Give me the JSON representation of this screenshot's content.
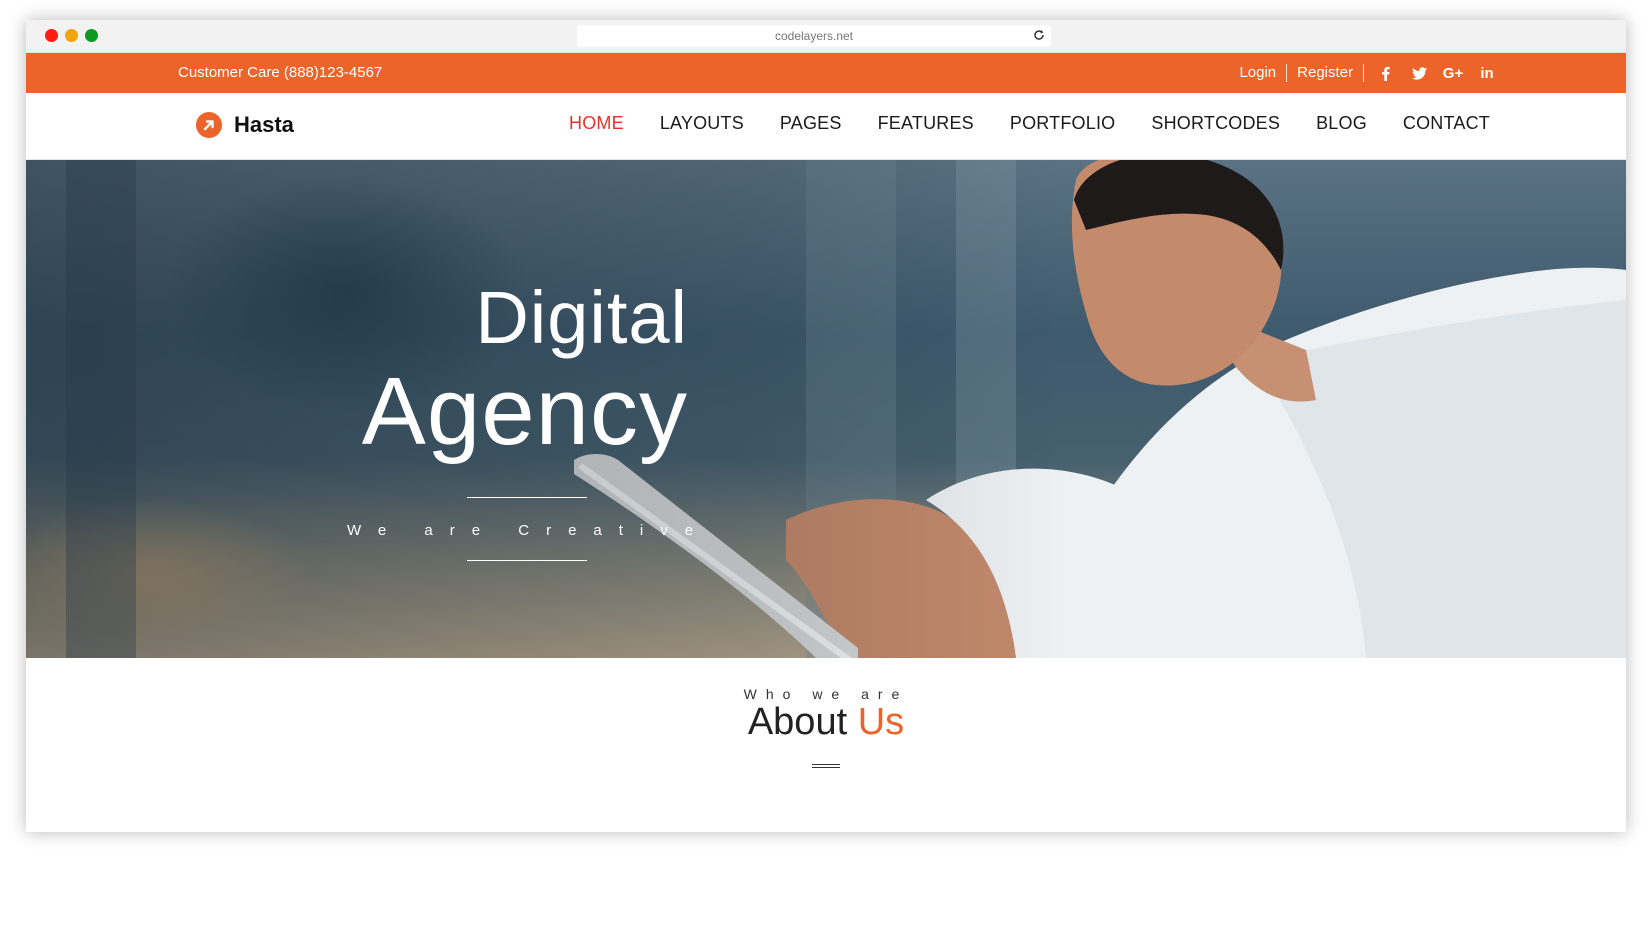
{
  "browser": {
    "url": "codelayers.net",
    "reload_icon": "reload-icon"
  },
  "topbar": {
    "customer_care": "Customer Care (888)123-4567",
    "login": "Login",
    "register": "Register",
    "social_icons": [
      "facebook-icon",
      "twitter-icon",
      "google-plus-icon",
      "linkedin-icon"
    ],
    "google_plus_label": "G+",
    "linkedin_label": "in",
    "background": "#ed642b"
  },
  "nav": {
    "brand": "Hasta",
    "items": [
      {
        "label": "HOME",
        "active": true
      },
      {
        "label": "LAYOUTS"
      },
      {
        "label": "PAGES"
      },
      {
        "label": "FEATURES"
      },
      {
        "label": "PORTFOLIO"
      },
      {
        "label": "SHORTCODES"
      },
      {
        "label": "BLOG"
      },
      {
        "label": "CONTACT"
      }
    ],
    "active_color": "#e8312a"
  },
  "hero": {
    "title_line1": "Digital",
    "title_line2": "Agency",
    "subtitle": "We are Creative"
  },
  "about": {
    "kicker": "Who we are",
    "title_main": "About",
    "title_accent": "Us",
    "accent_color": "#ed642b"
  }
}
